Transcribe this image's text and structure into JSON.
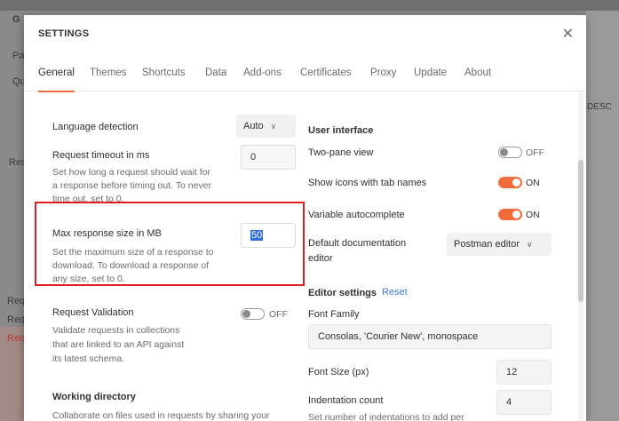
{
  "background": {
    "tab_partial": "G",
    "left_fragments": [
      "Pa",
      "Qu",
      "Res",
      "Requ",
      "Requ",
      "Requ"
    ],
    "right_fragment": "DESC"
  },
  "modal": {
    "title": "SETTINGS",
    "close_icon": "close-icon"
  },
  "tabs": [
    "General",
    "Themes",
    "Shortcuts",
    "Data",
    "Add-ons",
    "Certificates",
    "Proxy",
    "Update",
    "About"
  ],
  "active_tab": "General",
  "left": {
    "language_detection": {
      "label": "Language detection",
      "value": "Auto"
    },
    "request_timeout": {
      "label": "Request timeout in ms",
      "desc": [
        "Set how long a request should wait for",
        "a response before timing out. To never",
        "time out, set to 0."
      ],
      "value": "0"
    },
    "max_response": {
      "label": "Max response size in MB",
      "desc": [
        "Set the maximum size of a response to",
        "download. To download a response of",
        "any size, set to 0."
      ],
      "value": "50"
    },
    "request_validation": {
      "label": "Request Validation",
      "desc": [
        "Validate requests in collections",
        "that are linked to an API against",
        "its latest schema."
      ],
      "state": "OFF"
    },
    "working_directory": {
      "title": "Working directory",
      "desc": "Collaborate on files used in requests by sharing your"
    }
  },
  "right": {
    "ui_title": "User interface",
    "two_pane": {
      "label": "Two-pane view",
      "state": "OFF"
    },
    "icons_tab": {
      "label": "Show icons with tab names",
      "state": "ON"
    },
    "var_auto": {
      "label": "Variable autocomplete",
      "state": "ON"
    },
    "default_doc": {
      "label_line1": "Default documentation",
      "label_line2": "editor",
      "value": "Postman editor"
    },
    "editor_title": "Editor settings",
    "reset_label": "Reset",
    "font_family": {
      "label": "Font Family",
      "value": "Consolas, 'Courier New', monospace"
    },
    "font_size": {
      "label": "Font Size (px)",
      "value": "12"
    },
    "indent": {
      "label": "Indentation count",
      "desc": "Set number of indentations to add per",
      "value": "4"
    }
  },
  "colors": {
    "accent": "#f26b3a",
    "highlight_border": "#e02020",
    "link": "#3a7bd5"
  }
}
